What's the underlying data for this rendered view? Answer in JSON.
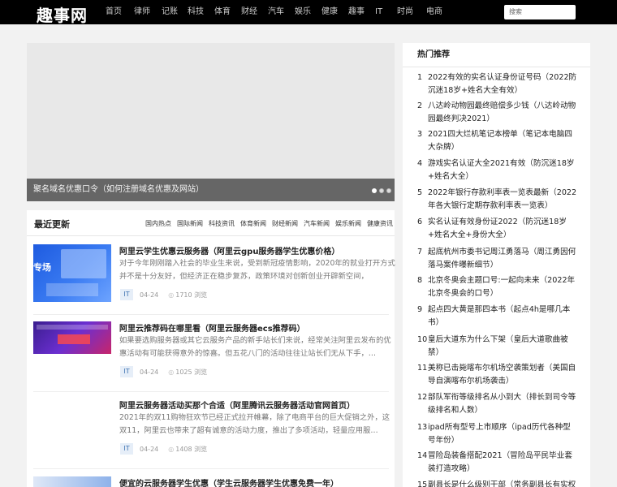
{
  "header": {
    "logo": "趣事网",
    "nav": [
      "首页",
      "律师",
      "记账",
      "科技",
      "体育",
      "财经",
      "汽车",
      "娱乐",
      "健康",
      "趣事",
      "IT",
      "时尚",
      "电商"
    ],
    "search_placeholder": "搜索"
  },
  "banner": {
    "caption": "聚名域名优惠口令（如何注册域名优惠及网站）"
  },
  "latest": {
    "title": "最近更新",
    "categories": [
      "国内热点",
      "国际新闻",
      "科技资讯",
      "体育新闻",
      "财经新闻",
      "汽车新闻",
      "娱乐新闻",
      "健康资讯"
    ],
    "articles": [
      {
        "title": "阿里云学生优惠云服务器（阿里云gpu服务器学生优惠价格）",
        "desc": "对于今年刚刚踏入社会的毕业生来说，受到新冠疫情影响，2020年的就业打开方式并不是十分友好，但经济正在稳步复苏，政策环境对创新创业开辟新空间，",
        "tag": "IT",
        "date": "04-24",
        "views": "1710 浏览",
        "thumb": "blue"
      },
      {
        "title": "阿里云推荐码在哪里看（阿里云服务器ecs推荐码）",
        "desc": "如果要选购服务器或其它云服务产品的新手站长们来说，经常关注阿里云发布的优惠活动有可能获得意外的惊喜。但五花八门的活动往往让站长们无从下手，…",
        "tag": "IT",
        "date": "04-24",
        "views": "1025 浏览",
        "thumb": "purple"
      },
      {
        "title": "阿里云服务器活动买那个合适（阿里腾讯云服务器活动官网首页）",
        "desc": "2021年的双11购物狂欢节已经正式拉开帷幕，除了电商平台的巨大促销之外，这双11，阿里云也带来了超有诚意的活动力度，推出了多项活动，轻量应用服…",
        "tag": "IT",
        "date": "04-24",
        "views": "1408 浏览",
        "thumb": "none"
      },
      {
        "title": "便宜的云服务器学生优惠（学生云服务器学生优惠免费一年）",
        "desc": "",
        "tag": "",
        "date": "",
        "views": "",
        "thumb": "small"
      }
    ]
  },
  "sidebar": {
    "title": "热门推荐",
    "items": [
      {
        "num": "1",
        "text": "2022有效的实名认证身份证号码（2022防沉迷18岁+姓名大全有效）"
      },
      {
        "num": "2",
        "text": "八达岭动物园最终赔偿多少钱（八达岭动物园最终判决2021）"
      },
      {
        "num": "3",
        "text": "2021四大烂机笔记本榜单（笔记本电脑四大杂牌）"
      },
      {
        "num": "4",
        "text": "游戏实名认证大全2021有效（防沉迷18岁+姓名大全）"
      },
      {
        "num": "5",
        "text": "2022年银行存款利率表一览表最新（2022年各大银行定期存款利率表一览表）"
      },
      {
        "num": "6",
        "text": "实名认证有效身份证2022（防沉迷18岁+姓名大全+身份大全）"
      },
      {
        "num": "7",
        "text": "起底杭州市委书记周江勇落马（周江勇因何落马案件曝新细节）"
      },
      {
        "num": "8",
        "text": "北京冬奥会主题口号:一起向未来（2022年北京冬奥会的口号）"
      },
      {
        "num": "9",
        "text": "起点四大黄是那四本书（起点4h是哪几本书）"
      },
      {
        "num": "10",
        "text": "皇后大道东为什么下架（皇后大道歌曲被禁）"
      },
      {
        "num": "11",
        "text": "美称已击毙喀布尔机场空袭策划者（美国自导自演喀布尔机场袭击）"
      },
      {
        "num": "12",
        "text": "部队军衔等级排名从小到大（排长到司令等级排名和人数）"
      },
      {
        "num": "13",
        "text": "ipad所有型号上市顺序（ipad历代各种型号年份）"
      },
      {
        "num": "14",
        "text": "冒险岛装备搭配2021（冒险岛平民毕业套装打造攻略）"
      },
      {
        "num": "15",
        "text": "副县长是什么级别干部（常务副县长有实权吗）"
      }
    ]
  }
}
